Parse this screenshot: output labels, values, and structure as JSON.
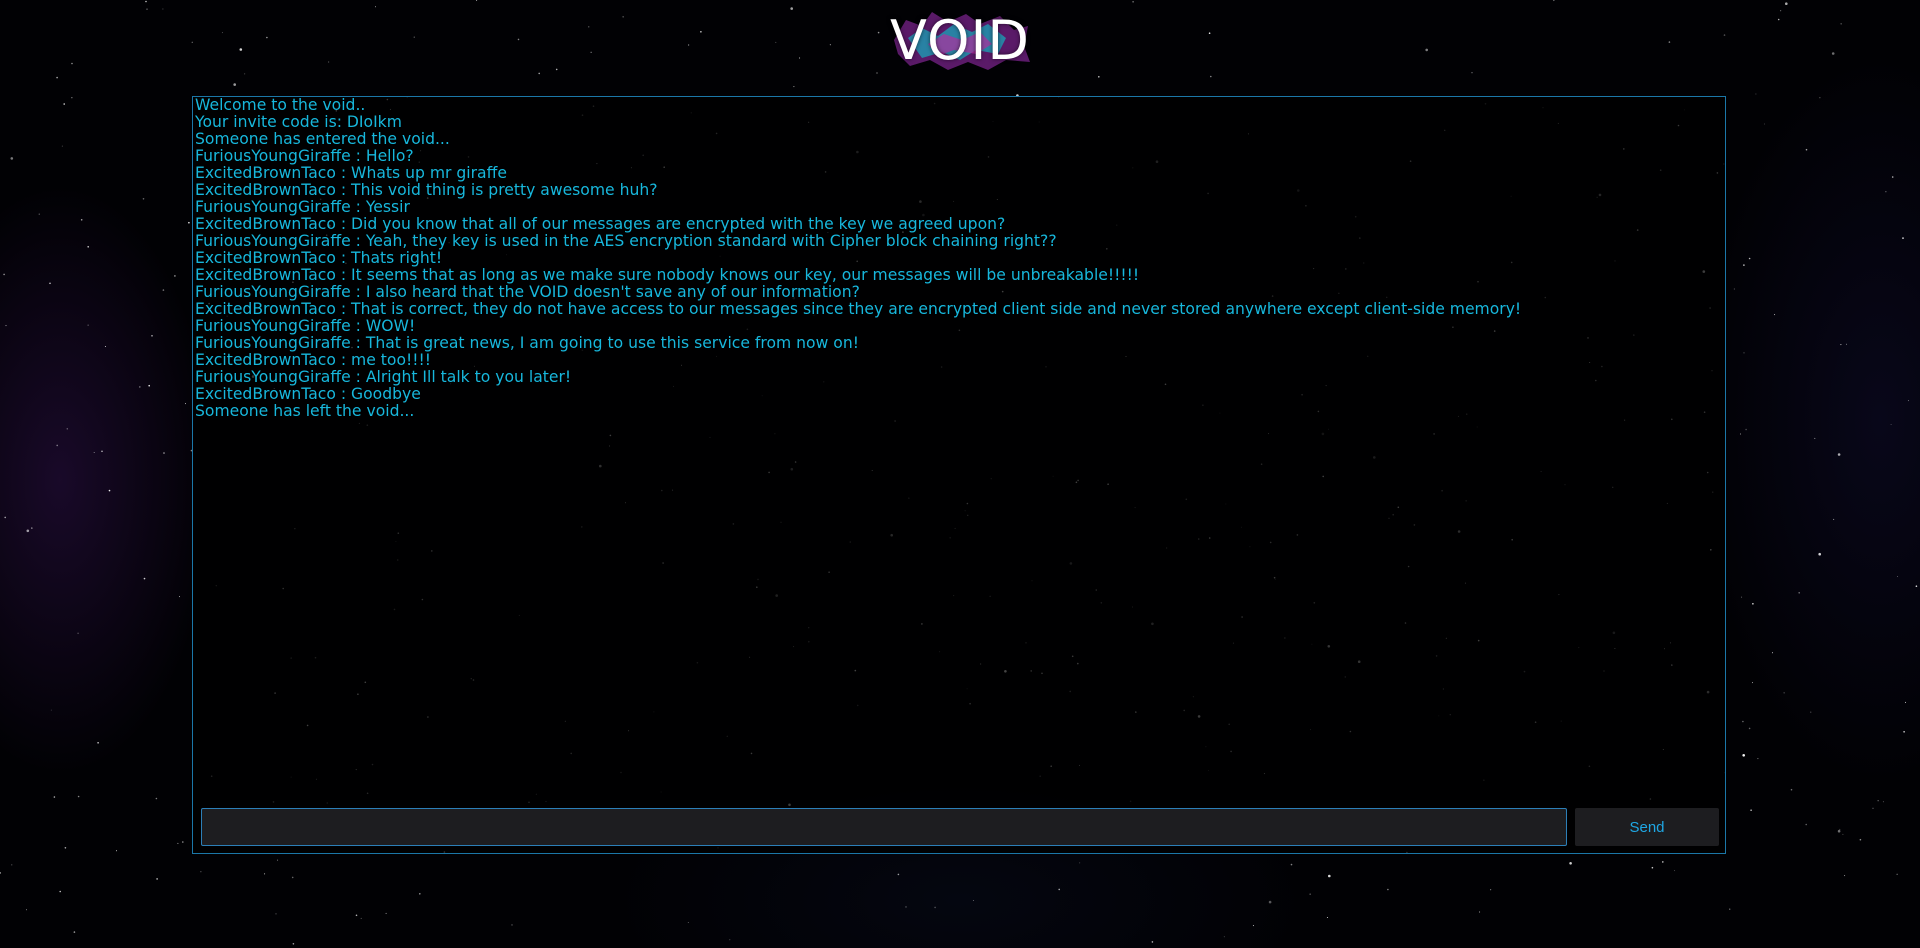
{
  "logo": {
    "text": "VOID"
  },
  "chat": {
    "messages": [
      "Welcome to the void..",
      "Your invite code is: DIoIkm",
      "Someone has entered the void...",
      "FuriousYoungGiraffe : Hello?",
      "ExcitedBrownTaco : Whats up mr giraffe",
      "ExcitedBrownTaco : This void thing is pretty awesome huh?",
      "FuriousYoungGiraffe : Yessir",
      "ExcitedBrownTaco : Did you know that all of our messages are encrypted with the key we agreed upon?",
      "FuriousYoungGiraffe : Yeah, they key is used in the AES encryption standard with Cipher block chaining right??",
      "ExcitedBrownTaco : Thats right!",
      "ExcitedBrownTaco : It seems that as long as we make sure nobody knows our key, our messages will be unbreakable!!!!!",
      "FuriousYoungGiraffe : I also heard that the VOID doesn't save any of our information?",
      "ExcitedBrownTaco : That is correct, they do not have access to our messages since they are encrypted client side and never stored anywhere except client-side memory!",
      "FuriousYoungGiraffe : WOW!",
      "FuriousYoungGiraffe : That is great news, I am going to use this service from now on!",
      "ExcitedBrownTaco : me too!!!!",
      "FuriousYoungGiraffe : Alright Ill talk to you later!",
      "ExcitedBrownTaco : Goodbye",
      "Someone has left the void..."
    ]
  },
  "composer": {
    "input_value": "",
    "input_placeholder": "",
    "send_label": "Send"
  },
  "colors": {
    "accent_text": "#17b7dc",
    "border": "#1b77a8",
    "send_text": "#1fa7e4",
    "background": "#010104"
  }
}
